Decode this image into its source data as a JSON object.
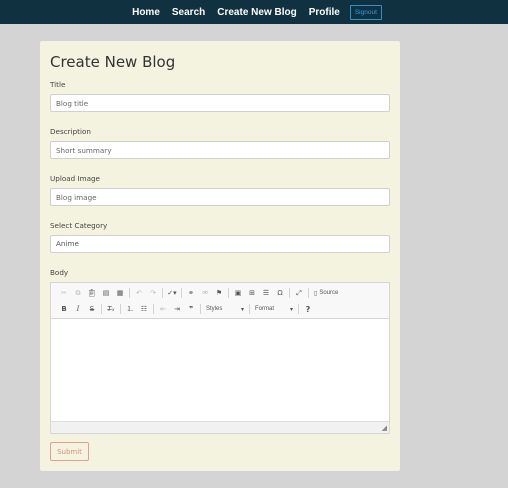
{
  "nav": {
    "items": [
      {
        "label": "Home"
      },
      {
        "label": "Search"
      },
      {
        "label": "Create New Blog"
      },
      {
        "label": "Profile"
      }
    ],
    "signout_label": "Signout"
  },
  "form": {
    "heading": "Create New Blog",
    "title_label": "Title",
    "title_placeholder": "Blog title",
    "description_label": "Description",
    "description_placeholder": "Short summary",
    "image_label": "Upload Image",
    "image_placeholder": "Blog image",
    "category_label": "Select Category",
    "category_value": "Anime",
    "body_label": "Body",
    "submit_label": "Submit"
  },
  "editor": {
    "source_label": "Source",
    "styles_label": "Styles",
    "format_label": "Format",
    "buttons_row1": [
      "cut-icon",
      "copy-icon",
      "paste-icon",
      "paste-text-icon",
      "paste-word-icon",
      "undo-icon",
      "redo-icon",
      "spellcheck-icon",
      "link-icon",
      "unlink-icon",
      "anchor-icon",
      "image-icon",
      "table-icon",
      "horizontal-line-icon",
      "special-char-icon",
      "maximize-icon",
      "source-icon"
    ],
    "buttons_row2": [
      "bold-icon",
      "italic-icon",
      "strike-icon",
      "remove-format-icon",
      "numbered-list-icon",
      "bulleted-list-icon",
      "outdent-icon",
      "indent-icon",
      "blockquote-icon",
      "help-icon"
    ]
  },
  "colors": {
    "navbar_bg": "#0f3140",
    "card_bg": "#f3f3df",
    "page_bg": "#d4d4d4",
    "submit_accent": "#e0907a",
    "signout_accent": "#3a9ce0"
  }
}
